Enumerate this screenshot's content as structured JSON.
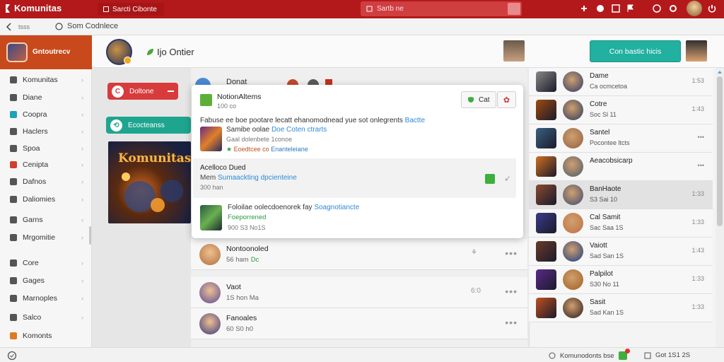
{
  "topbar": {
    "app_title": "Komunitas",
    "tab_label": "Sarcti Cibonte",
    "search_placeholder": "Sartb ne"
  },
  "navbar": {
    "back_tag": "tsss",
    "breadcrumb": "Som Codnlece"
  },
  "sidebar": {
    "profile_name": "Gntoutrecv",
    "items": [
      {
        "label": "Komunitas",
        "icon_color": "#555555"
      },
      {
        "label": "Diane",
        "icon_color": "#555555"
      },
      {
        "label": "Coopra",
        "icon_color": "#1fa2b8"
      },
      {
        "label": "Haclers",
        "icon_color": "#555555"
      },
      {
        "label": "Spoa",
        "icon_color": "#555555"
      },
      {
        "label": "Cenipta",
        "icon_color": "#d0402a"
      },
      {
        "label": "Dafnos",
        "icon_color": "#555555"
      },
      {
        "label": "Daliomies",
        "icon_color": "#555555"
      },
      {
        "label": "Garns",
        "icon_color": "#555555"
      },
      {
        "label": "Mrgomitie",
        "icon_color": "#555555"
      },
      {
        "label": "Core",
        "icon_color": "#555555"
      },
      {
        "label": "Gages",
        "icon_color": "#555555"
      },
      {
        "label": "Marnoples",
        "icon_color": "#555555"
      },
      {
        "label": "Salco",
        "icon_color": "#555555"
      },
      {
        "label": "Komonts",
        "icon_color": "#e07a20"
      }
    ]
  },
  "main_header": {
    "title": "Ijo Ontier",
    "cta_button": "Con bastic hicis"
  },
  "left_feed": {
    "red_pill": "Doltone",
    "teal_pill": "Ecocteanss",
    "banner_title": "Komunitas"
  },
  "center_top": {
    "label": "Donat"
  },
  "popup": {
    "header_title": "NotionAltems",
    "header_sub": "100 co",
    "green_button": "Cat",
    "description": "Fabuse ee boe pootare lecatt ehanomodnead yue sot onlegrents",
    "description_link": "Bactte",
    "item1_title": "Samibe oolae",
    "item1_link": "Doe Coten ctrarts",
    "item1_sub": "Gaal dolenbete 1conoe",
    "item1_meta": "Eoedtcee co",
    "item1_meta2": "Enanteleiane",
    "item2_title": "Acelloco Dued",
    "item2_prefix": "Mem",
    "item2_link": "Sumaackting dpcienteine",
    "item2_sub": "300 han",
    "item3_title": "Foloilae oolecdoenorek fay",
    "item3_link": "Soagnotiancte",
    "item3_sub": "Foeporrened",
    "item3_meta": "900 S3 No1S"
  },
  "center_rows": [
    {
      "name": "Nontoonoled",
      "sub": "56 ham",
      "sub_accent": "Dc",
      "avatar_color": "#b07040",
      "has_dots": true,
      "mid": "⚘"
    },
    {
      "name": "Vaot",
      "sub": "1S hon Ma",
      "sub_accent": "",
      "avatar_color": "#5a4a9a",
      "has_dots": true,
      "mid": "6:0"
    },
    {
      "name": "Fanoales",
      "sub": "60 S0 h0",
      "sub_accent": "",
      "avatar_color": "#3a3a80",
      "has_dots": true,
      "mid": ""
    }
  ],
  "right_rows": [
    {
      "name": "Dame",
      "sub": "Ca ocmcetoa",
      "time": "1:53",
      "c1": "#888888",
      "c2": "#2a3a6a"
    },
    {
      "name": "Cotre",
      "sub": "Soc Sl 11",
      "time": "1:43",
      "c1": "#a04a10",
      "c2": "#2a3a5a"
    },
    {
      "name": "Santel",
      "sub": "Pocontee ltcts",
      "time": "",
      "c1": "#3a6080",
      "c2": "#906040"
    },
    {
      "name": "Aeacobsicarp",
      "sub": "",
      "time": "",
      "c1": "#d07020",
      "c2": "#4a5a6a"
    },
    {
      "name": "BanHaote",
      "sub": "S3 Sai 10",
      "time": "1:33",
      "c1": "#8a4a30",
      "c2": "#3a4a70"
    },
    {
      "name": "Cal Samit",
      "sub": "Sac Saa 1S",
      "time": "1:33",
      "c1": "#3a3a8a",
      "c2": "#c07040"
    },
    {
      "name": "Vaiott",
      "sub": "Sad San 1S",
      "time": "1:43",
      "c1": "#6a3a2a",
      "c2": "#1a3a80"
    },
    {
      "name": "Palpilot",
      "sub": "S30 No 11",
      "time": "1:33",
      "c1": "#5a2a8a",
      "c2": "#a06020"
    },
    {
      "name": "Sasit",
      "sub": "Sad Kan 1S",
      "time": "1:33",
      "c1": "#c05020",
      "c2": "#2a1a1a"
    }
  ],
  "bottombar": {
    "status1": "Komunodonts bse",
    "status2": "Got 1S1 2S"
  }
}
